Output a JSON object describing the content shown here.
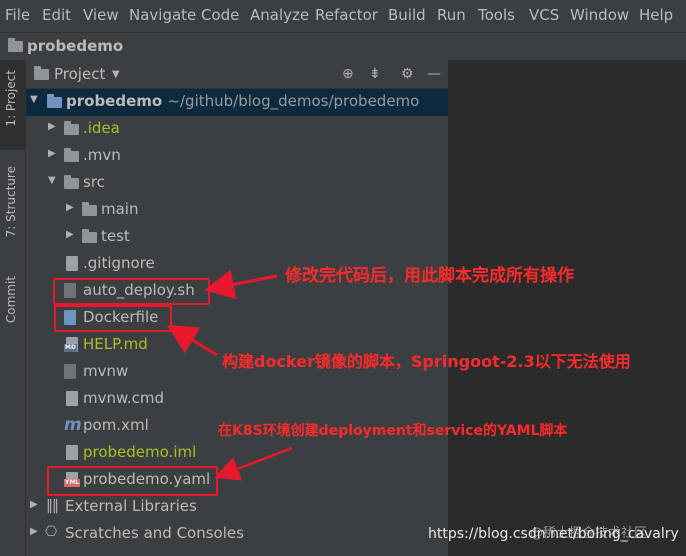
{
  "menu": [
    "File",
    "Edit",
    "View",
    "Navigate",
    "Code",
    "Analyze",
    "Refactor",
    "Build",
    "Run",
    "Tools",
    "VCS",
    "Window",
    "Help"
  ],
  "navbar": {
    "title": "probedemo"
  },
  "sidebar": {
    "tabs": [
      "1: Project",
      "7: Structure",
      "Commit"
    ]
  },
  "panel": {
    "title": "Project"
  },
  "tree": {
    "root_name": "probedemo",
    "root_path": "~/github/blog_demos/probedemo",
    "items": [
      ".idea",
      ".mvn",
      "src",
      "main",
      "test",
      ".gitignore",
      "auto_deploy.sh",
      "Dockerfile",
      "HELP.md",
      "mvnw",
      "mvnw.cmd",
      "pom.xml",
      "probedemo.iml",
      "probedemo.yaml",
      "External Libraries",
      "Scratches and Consoles"
    ]
  },
  "annotations": {
    "auto_deploy": "修改完代码后，用此脚本完成所有操作",
    "dockerfile": "构建docker镜像的脚本，Springoot-2.3以下无法使用",
    "yaml": "在K8S环境创建deployment和service的YAML脚本"
  },
  "watermark": {
    "text": "https://blog.csdn.net/boling_cavalry",
    "site": "@稀土掘金技术社区"
  },
  "colors": {
    "annotation": "#ff2a2a",
    "selected": "#0d293e",
    "accent_green": "#a8c023"
  }
}
